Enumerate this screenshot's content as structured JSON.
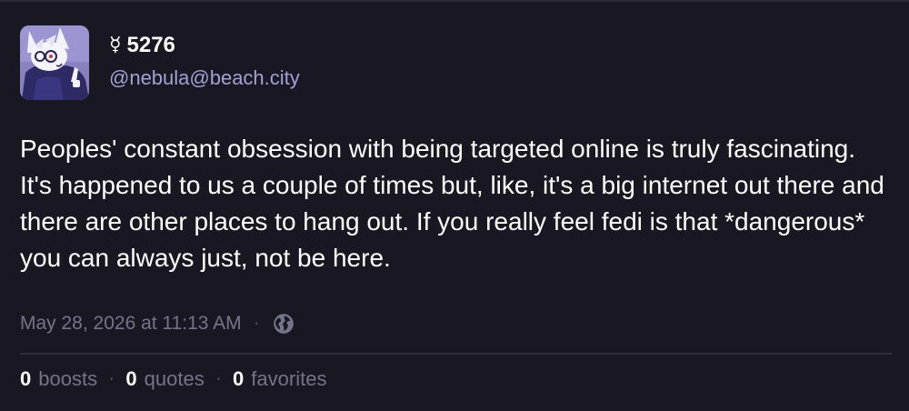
{
  "status": {
    "author": {
      "display_glyph": "☿",
      "display_name": "5276",
      "acct": "@nebula@beach.city"
    },
    "content": "Peoples' constant obsession with being targeted online is truly fascinating. It's happened to us a couple of times but, like, it's a big internet out there and there are other places to hang out. If you really feel fedi is that *dangerous* you can always just, not be here.",
    "timestamp": "May 28, 2026 at 11:13 AM",
    "visibility_icon": "globe-icon",
    "separator": "·",
    "counts": {
      "boosts_num": "0",
      "boosts_label": "boosts",
      "quotes_num": "0",
      "quotes_label": "quotes",
      "favorites_num": "0",
      "favorites_label": "favorites"
    }
  },
  "colors": {
    "background": "#191822",
    "acct": "#a4a0d6",
    "muted": "#75738a",
    "text": "#ffffff"
  }
}
